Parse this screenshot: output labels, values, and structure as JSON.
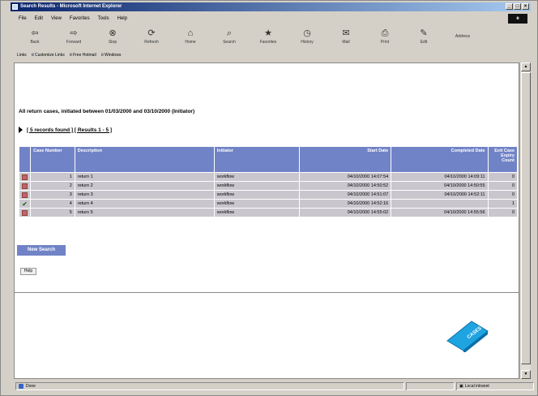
{
  "window": {
    "title": "Search Results - Microsoft Internet Explorer",
    "controls": [
      "_",
      "□",
      "×"
    ]
  },
  "menu": [
    "File",
    "Edit",
    "View",
    "Favorites",
    "Tools",
    "Help"
  ],
  "toolbar": [
    {
      "label": "Back",
      "icon": "back-arrow-icon",
      "glyph": "⇦"
    },
    {
      "label": "Forward",
      "icon": "forward-arrow-icon",
      "glyph": "⇨"
    },
    {
      "label": "Stop",
      "icon": "stop-icon",
      "glyph": "⊗"
    },
    {
      "label": "Refresh",
      "icon": "refresh-icon",
      "glyph": "⟳"
    },
    {
      "label": "Home",
      "icon": "home-icon",
      "glyph": "⌂"
    },
    {
      "label": "Search",
      "icon": "search-icon",
      "glyph": "⌕"
    },
    {
      "label": "Favorites",
      "icon": "favorites-icon",
      "glyph": "★"
    },
    {
      "label": "History",
      "icon": "history-icon",
      "glyph": "◷"
    },
    {
      "label": "Mail",
      "icon": "mail-icon",
      "glyph": "✉"
    },
    {
      "label": "Print",
      "icon": "print-icon",
      "glyph": "⎙"
    },
    {
      "label": "Edit",
      "icon": "edit-icon",
      "glyph": "✎"
    }
  ],
  "toolbar_extra": "Address",
  "links": {
    "label": "Links",
    "items": [
      "Customize Links",
      "Free Hotmail",
      "Windows"
    ]
  },
  "page": {
    "heading": "All return cases, initiated between 01/03/2000 and 03/10/2000 (Initiator)",
    "found_text": "[ 5 records found ] [ Results 1 - 5 ]",
    "columns": [
      "",
      "Case Number",
      "Description",
      "Initiator",
      "Start Date",
      "Completed Date",
      "Exit Case Expiry Count"
    ],
    "rows": [
      {
        "status": "red",
        "number": "1",
        "description": "return 1",
        "initiator": "workflow",
        "start": "04/10/2000 14:07:54",
        "completed": "04/10/2000 14:09:11",
        "count": "0"
      },
      {
        "status": "red",
        "number": "2",
        "description": "return 2",
        "initiator": "workflow",
        "start": "04/10/2000 14:50:52",
        "completed": "04/10/2000 14:50:55",
        "count": "0"
      },
      {
        "status": "red",
        "number": "3",
        "description": "return 3",
        "initiator": "workflow",
        "start": "04/10/2000 14:51:07",
        "completed": "04/10/2000 14:52:11",
        "count": "0"
      },
      {
        "status": "check",
        "number": "4",
        "description": "return 4",
        "initiator": "workflow",
        "start": "04/10/2000 14:52:16",
        "completed": "",
        "count": "1"
      },
      {
        "status": "red",
        "number": "5",
        "description": "return 5",
        "initiator": "workflow",
        "start": "04/10/2000 14:55:02",
        "completed": "04/10/2000 14:55:56",
        "count": "0"
      }
    ],
    "new_search_label": "New Search",
    "help_label": "Help"
  },
  "brand_text": "CASES",
  "status": {
    "left": "Done",
    "zone": "Local intranet"
  },
  "colors": {
    "header_blue": "#7183c7",
    "row_gray": "#c9c6cd",
    "status_red": "#c36271",
    "brand_cyan": "#1ea4e0"
  }
}
